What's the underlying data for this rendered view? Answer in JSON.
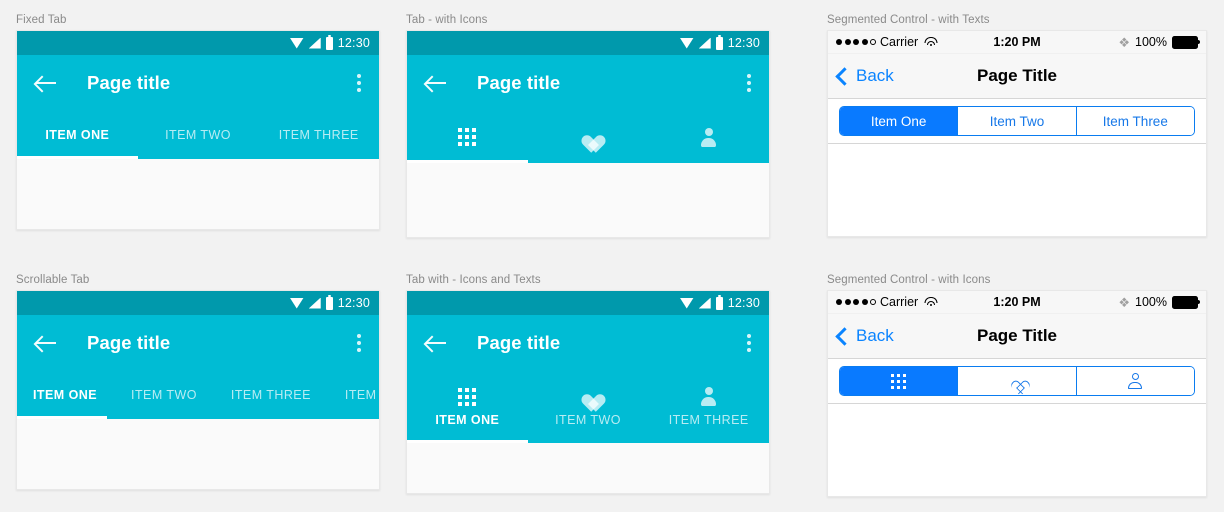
{
  "theme": {
    "android_status_bar": "#0099ac",
    "android_app_bar": "#00bcd4",
    "ios_blue": "#097aff",
    "page_bg": "#f2f2f2",
    "card_bg": "#fafafa"
  },
  "sections": [
    {
      "id": "fixed-tab",
      "label": "Fixed Tab",
      "platform": "android",
      "status_bar": {
        "time": "12:30",
        "icons": [
          "wifi-icon",
          "signal-icon",
          "battery-icon"
        ]
      },
      "app_bar": {
        "title": "Page title",
        "back": "back-arrow-icon",
        "overflow": "more-vert-icon"
      },
      "tabs": {
        "mode": "text",
        "items": [
          {
            "label": "ITEM ONE",
            "active": true
          },
          {
            "label": "ITEM TWO",
            "active": false
          },
          {
            "label": "ITEM THREE",
            "active": false
          }
        ]
      }
    },
    {
      "id": "tab-with-icons",
      "label": "Tab - with Icons",
      "platform": "android",
      "status_bar": {
        "time": "12:30",
        "icons": [
          "wifi-icon",
          "signal-icon",
          "battery-icon"
        ]
      },
      "app_bar": {
        "title": "Page title",
        "back": "back-arrow-icon",
        "overflow": "more-vert-icon"
      },
      "tabs": {
        "mode": "icon",
        "items": [
          {
            "icon": "grid-icon",
            "label": "",
            "active": true
          },
          {
            "icon": "heart-icon",
            "label": "",
            "active": false
          },
          {
            "icon": "person-icon",
            "label": "",
            "active": false
          }
        ]
      }
    },
    {
      "id": "segmented-control-texts",
      "label": "Segmented Control - with Texts",
      "platform": "ios",
      "status_bar": {
        "carrier": "Carrier",
        "time": "1:20 PM",
        "battery_percent": "100%",
        "signal_dots_filled": 4,
        "signal_dots_total": 5
      },
      "nav_bar": {
        "back_label": "Back",
        "title": "Page Title"
      },
      "segments": {
        "mode": "text",
        "items": [
          {
            "label": "Item One",
            "selected": true
          },
          {
            "label": "Item Two",
            "selected": false
          },
          {
            "label": "Item Three",
            "selected": false
          }
        ]
      }
    },
    {
      "id": "scrollable-tab",
      "label": "Scrollable Tab",
      "platform": "android",
      "status_bar": {
        "time": "12:30",
        "icons": [
          "wifi-icon",
          "signal-icon",
          "battery-icon"
        ]
      },
      "app_bar": {
        "title": "Page title",
        "back": "back-arrow-icon",
        "overflow": "more-vert-icon"
      },
      "tabs": {
        "mode": "scrollable",
        "items": [
          {
            "label": "ITEM ONE",
            "active": true
          },
          {
            "label": "ITEM TWO",
            "active": false
          },
          {
            "label": "ITEM THREE",
            "active": false
          },
          {
            "label": "ITEM FOUR",
            "active": false
          }
        ]
      }
    },
    {
      "id": "tab-icons-and-texts",
      "label": "Tab with - Icons and Texts",
      "platform": "android",
      "status_bar": {
        "time": "12:30",
        "icons": [
          "wifi-icon",
          "signal-icon",
          "battery-icon"
        ]
      },
      "app_bar": {
        "title": "Page title",
        "back": "back-arrow-icon",
        "overflow": "more-vert-icon"
      },
      "tabs": {
        "mode": "icon-text",
        "items": [
          {
            "icon": "grid-icon",
            "label": "ITEM ONE",
            "active": true
          },
          {
            "icon": "heart-icon",
            "label": "ITEM TWO",
            "active": false
          },
          {
            "icon": "person-icon",
            "label": "ITEM THREE",
            "active": false
          }
        ]
      }
    },
    {
      "id": "segmented-control-icons",
      "label": "Segmented Control - with Icons",
      "platform": "ios",
      "status_bar": {
        "carrier": "Carrier",
        "time": "1:20 PM",
        "battery_percent": "100%",
        "signal_dots_filled": 4,
        "signal_dots_total": 5
      },
      "nav_bar": {
        "back_label": "Back",
        "title": "Page Title"
      },
      "segments": {
        "mode": "icon",
        "items": [
          {
            "icon": "grid-icon",
            "label": "",
            "selected": true
          },
          {
            "icon": "heart-outline-icon",
            "label": "",
            "selected": false
          },
          {
            "icon": "person-outline-icon",
            "label": "",
            "selected": false
          }
        ]
      }
    }
  ]
}
